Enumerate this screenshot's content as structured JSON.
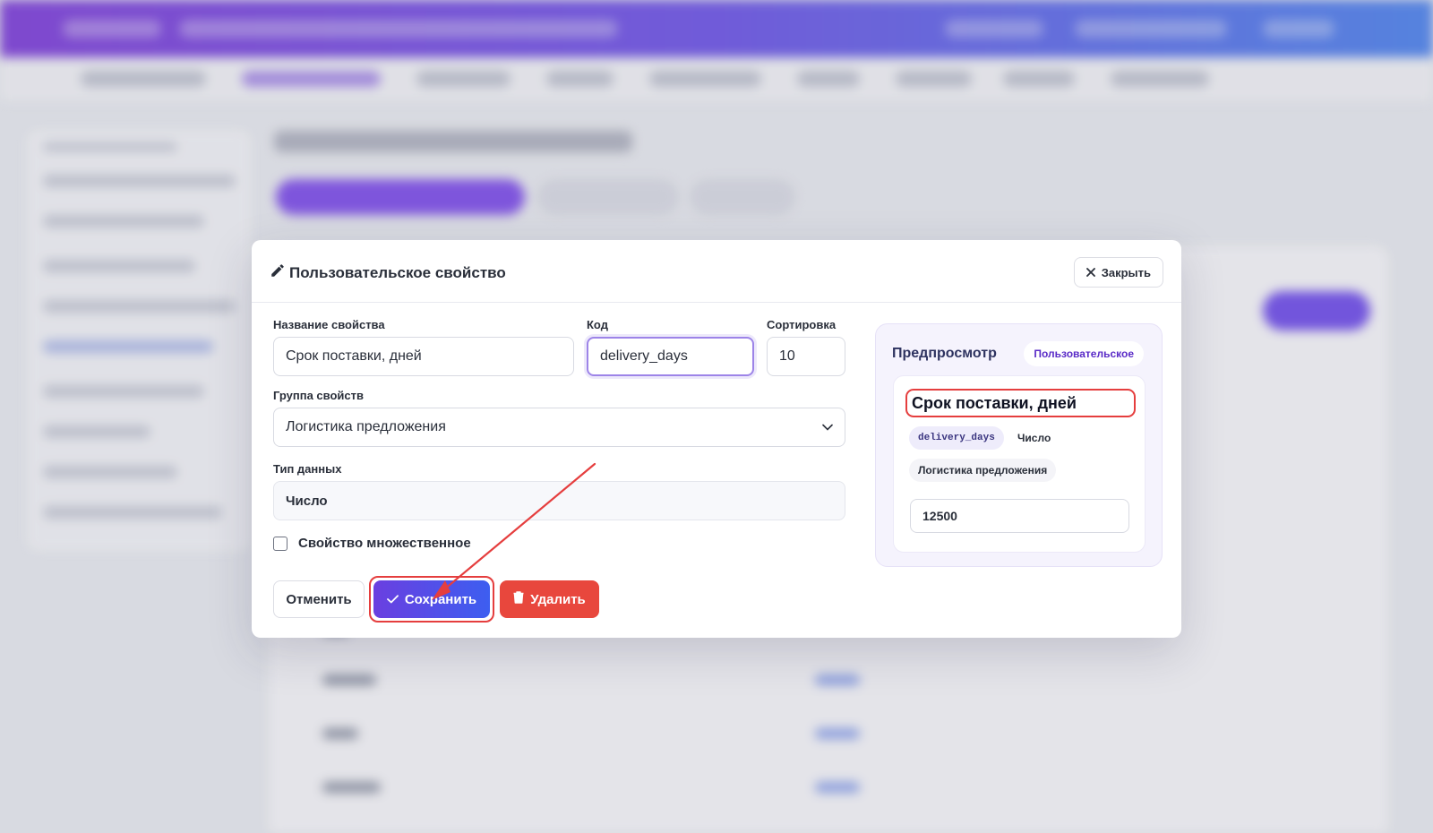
{
  "modal": {
    "title": "Пользовательское свойство",
    "close_label": "Закрыть",
    "fields": {
      "name_label": "Название свойства",
      "name_value": "Срок поставки, дней",
      "code_label": "Код",
      "code_value": "delivery_days",
      "sort_label": "Сортировка",
      "sort_value": "10",
      "group_label": "Группа свойств",
      "group_value": "Логистика предложения",
      "type_label": "Тип данных",
      "type_value": "Число",
      "multiple_label": "Свойство множественное"
    },
    "buttons": {
      "cancel_label": "Отменить",
      "save_label": "Сохранить",
      "delete_label": "Удалить"
    },
    "preview": {
      "title": "Предпросмотр",
      "badge": "Пользовательское",
      "name": "Срок поставки, дней",
      "code_tag": "delivery_days",
      "type_tag": "Число",
      "group_tag": "Логистика предложения",
      "sample_value": "12500"
    }
  },
  "colors": {
    "primary_gradient_start": "#6a3fe0",
    "primary_gradient_end": "#3d5ef0",
    "danger": "#e8473d",
    "highlight": "#e53e3e"
  },
  "icons": [
    "pencil-icon",
    "close-icon",
    "chevron-down-icon",
    "check-icon",
    "trash-icon",
    "arrow-annotation"
  ]
}
